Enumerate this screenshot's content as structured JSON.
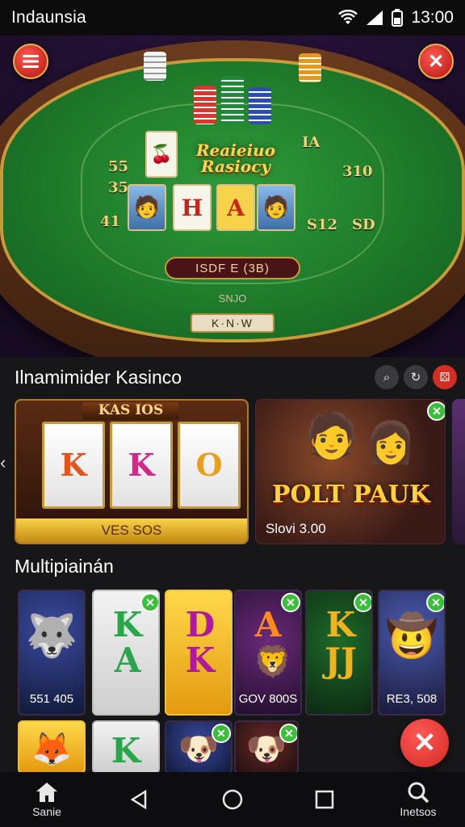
{
  "status_bar": {
    "carrier": "Indaunsia",
    "time": "13:00"
  },
  "hero": {
    "logo_line1": "Reaieiuo",
    "logo_line2": "Rasiocy",
    "cards": [
      "H",
      "A"
    ],
    "left_values": [
      "55",
      "35",
      "41"
    ],
    "right_values": [
      "IA",
      "310",
      "S12",
      "SD"
    ],
    "pill_text": "ISDF E (3B)",
    "tray_label": "SNJO",
    "tray_text": "K·N·W"
  },
  "section1": {
    "title": "Ilnamimider Kasinco"
  },
  "featured": [
    {
      "banner": "KAS IOS",
      "reels": [
        "K",
        "K",
        "O"
      ],
      "button": "VES SOS"
    },
    {
      "title": "POLT PAUK",
      "caption": "Slovi 3.00"
    }
  ],
  "section2": {
    "title": "Multipiainán"
  },
  "tiles": [
    {
      "sym": "🐺",
      "caption": "551 405"
    },
    {
      "sym": "K A",
      "caption": ""
    },
    {
      "sym": "D K",
      "caption": ""
    },
    {
      "sym": "A",
      "caption": "GOV 800S"
    },
    {
      "sym": "K JJ",
      "caption": ""
    },
    {
      "sym": "🤠",
      "caption": "RE3, 508"
    }
  ],
  "tiles_row2": [
    "🦊",
    "K",
    "🐶",
    "🐶"
  ],
  "nav": {
    "home": "Sanie",
    "search": "Inetsos"
  },
  "colors": {
    "accent": "#d42823",
    "felt": "#1e7a2a",
    "gold": "#ffd23a"
  }
}
